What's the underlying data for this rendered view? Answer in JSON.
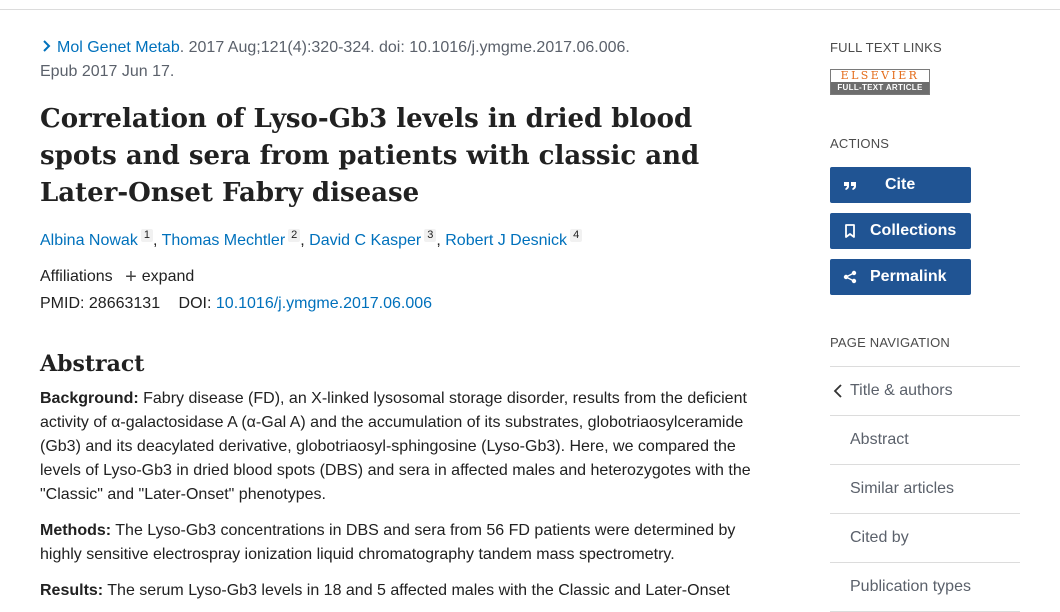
{
  "citation": {
    "journal": "Mol Genet Metab",
    "details": ". 2017 Aug;121(4):320-324. doi: 10.1016/j.ymgme.2017.06.006.",
    "epub": "Epub 2017 Jun 17."
  },
  "article": {
    "title": "Correlation of Lyso-Gb3 levels in dried blood spots and sera from patients with classic and Later-Onset Fabry disease"
  },
  "authors": [
    {
      "name": "Albina Nowak",
      "aff": "1"
    },
    {
      "name": "Thomas Mechtler",
      "aff": "2"
    },
    {
      "name": "David C Kasper",
      "aff": "3"
    },
    {
      "name": "Robert J Desnick",
      "aff": "4"
    }
  ],
  "affiliations": {
    "label": "Affiliations",
    "expand_label": "expand"
  },
  "ids": {
    "pmid_label": "PMID:",
    "pmid": "28663131",
    "doi_label": "DOI:",
    "doi": "10.1016/j.ymgme.2017.06.006"
  },
  "abstract": {
    "heading": "Abstract",
    "sections": [
      {
        "label": "Background:",
        "text": " Fabry disease (FD), an X-linked lysosomal storage disorder, results from the deficient activity of α-galactosidase A (α-Gal A) and the accumulation of its substrates, globotriaosylceramide (Gb3) and its deacylated derivative, globotriaosyl-sphingosine (Lyso-Gb3). Here, we compared the levels of Lyso-Gb3 in dried blood spots (DBS) and sera in affected males and heterozygotes with the \"Classic\" and \"Later-Onset\" phenotypes."
      },
      {
        "label": "Methods:",
        "text": " The Lyso-Gb3 concentrations in DBS and sera from 56 FD patients were determined by highly sensitive electrospray ionization liquid chromatography tandem mass spectrometry."
      },
      {
        "label": "Results:",
        "text": " The serum Lyso-Gb3 levels in 18 and 5 affected males with the Classic and Later-Onset"
      }
    ]
  },
  "sidebar": {
    "full_text_heading": "FULL TEXT LINKS",
    "elsevier_top": "ELSEVIER",
    "elsevier_bottom": "FULL-TEXT ARTICLE",
    "actions_heading": "ACTIONS",
    "actions": {
      "cite": "Cite",
      "collections": "Collections",
      "permalink": "Permalink"
    },
    "nav_heading": "PAGE NAVIGATION",
    "nav_items": [
      "Title & authors",
      "Abstract",
      "Similar articles",
      "Cited by",
      "Publication types"
    ]
  },
  "colors": {
    "link": "#0071bc",
    "button": "#205493",
    "elsevier_orange": "#e46c1a"
  }
}
